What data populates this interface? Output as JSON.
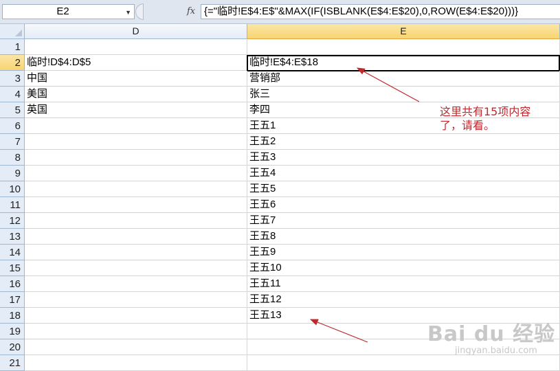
{
  "formula_bar": {
    "name_box": "E2",
    "fx_label": "fx",
    "formula": "{=\"临时!E$4:E$\"&MAX(IF(ISBLANK(E$4:E$20),0,ROW(E$4:E$20)))}"
  },
  "columns": [
    "D",
    "E"
  ],
  "rows": [
    {
      "num": "1",
      "d": "",
      "e": ""
    },
    {
      "num": "2",
      "d": "临时!D$4:D$5",
      "e": "临时!E$4:E$18"
    },
    {
      "num": "3",
      "d": "中国",
      "e": "营销部"
    },
    {
      "num": "4",
      "d": "美国",
      "e": "张三"
    },
    {
      "num": "5",
      "d": "英国",
      "e": "李四"
    },
    {
      "num": "6",
      "d": "",
      "e": "王五1"
    },
    {
      "num": "7",
      "d": "",
      "e": "王五2"
    },
    {
      "num": "8",
      "d": "",
      "e": "王五3"
    },
    {
      "num": "9",
      "d": "",
      "e": "王五4"
    },
    {
      "num": "10",
      "d": "",
      "e": "王五5"
    },
    {
      "num": "11",
      "d": "",
      "e": "王五6"
    },
    {
      "num": "12",
      "d": "",
      "e": "王五7"
    },
    {
      "num": "13",
      "d": "",
      "e": "王五8"
    },
    {
      "num": "14",
      "d": "",
      "e": "王五9"
    },
    {
      "num": "15",
      "d": "",
      "e": "王五10"
    },
    {
      "num": "16",
      "d": "",
      "e": "王五11"
    },
    {
      "num": "17",
      "d": "",
      "e": "王五12"
    },
    {
      "num": "18",
      "d": "",
      "e": "王五13"
    },
    {
      "num": "19",
      "d": "",
      "e": ""
    },
    {
      "num": "20",
      "d": "",
      "e": ""
    },
    {
      "num": "21",
      "d": "",
      "e": ""
    }
  ],
  "selection": {
    "row": "2",
    "column": "E"
  },
  "annotation": {
    "line1": "这里共有15项内容",
    "line2": "了，请看。",
    "color": "#c0282d"
  },
  "watermark": {
    "brand": "Bai du 经验",
    "url": "jingyan.baidu.com"
  }
}
